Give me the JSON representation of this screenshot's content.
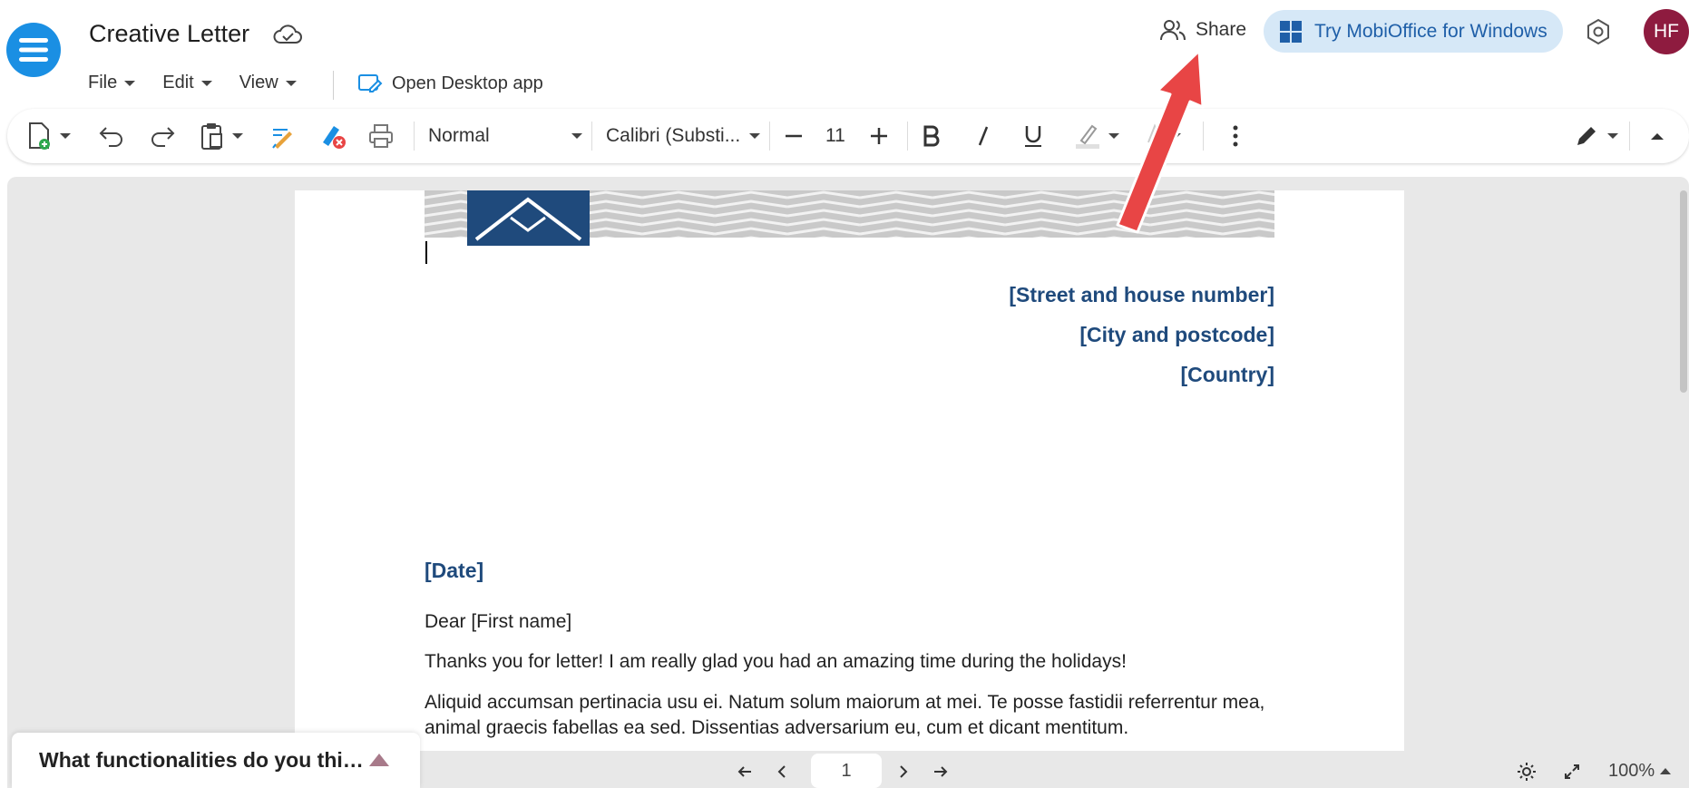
{
  "header": {
    "title": "Creative Letter",
    "menus": [
      "File",
      "Edit",
      "View"
    ],
    "open_desktop_label": "Open Desktop app",
    "share_label": "Share",
    "try_label": "Try MobiOffice for Windows",
    "avatar_initials": "HF"
  },
  "toolbar": {
    "style_value": "Normal",
    "font_value": "Calibri (Substi...",
    "font_size": "11"
  },
  "document": {
    "address": [
      "[Street and house number]",
      "[City and postcode]",
      "[Country]"
    ],
    "date": "[Date]",
    "greeting": "Dear [First name]",
    "para1": "Thanks you for letter! I am really glad you had an amazing time during the holidays!",
    "para2": "Aliquid accumsan pertinacia usu ei. Natum solum maiorum at mei. Te posse fastidii referrentur mea, animal graecis fabellas ea sed. Dissentias adversarium eu, cum et dicant mentitum."
  },
  "footer": {
    "feedback_text": "What functionalities do you thi…",
    "page_number": "1",
    "zoom_level": "100%"
  },
  "colors": {
    "accent_blue": "#1a8fe3",
    "heading_blue": "#1f4a7c",
    "avatar": "#8e1b3f",
    "annotation_arrow": "#e84545"
  }
}
